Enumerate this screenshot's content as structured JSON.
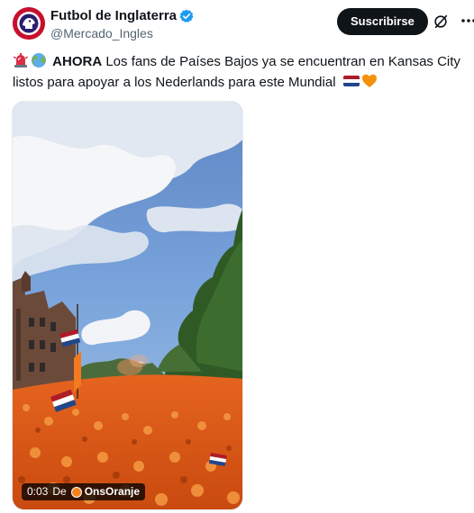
{
  "post": {
    "display_name": "Futbol de Inglaterra",
    "handle": "@Mercado_Ingles",
    "verified": true,
    "subscribe_label": "Suscribirse",
    "text_bold": "AHORA",
    "text_line1_rest": " Los fans de Países Bajos ya se encuentran en Kansas City",
    "text_line2": "listos para apoyar a los Nederlands para este Mundial",
    "emojis": [
      "police-light-icon",
      "globe-icon",
      "netherlands-flag-icon",
      "orange-heart-icon"
    ]
  },
  "video": {
    "time": "0:03",
    "from_label": "De",
    "source": "OnsOranje"
  },
  "colors": {
    "accent": "#1d9bf0",
    "text": "#0f1419",
    "muted": "#536471",
    "orange": "#f47a1f"
  }
}
